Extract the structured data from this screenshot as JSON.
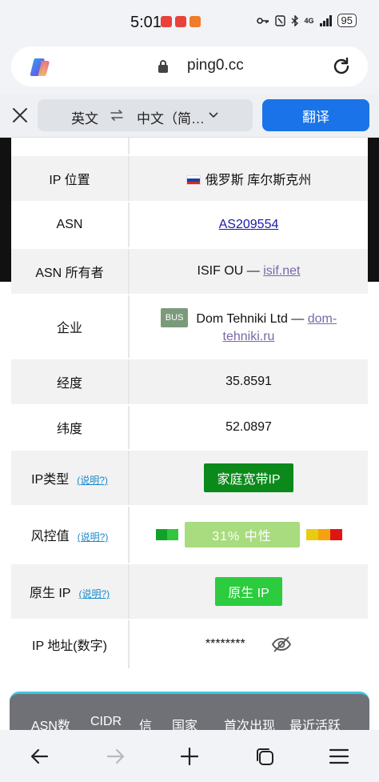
{
  "status_bar": {
    "time": "5:01",
    "network": "4G",
    "battery": "95"
  },
  "address_bar": {
    "url": "ping0.cc"
  },
  "translate_bar": {
    "source_lang": "英文",
    "target_lang": "中文（简…",
    "translate_label": "翻译"
  },
  "table": {
    "rows": [
      {
        "label": "IP 位置",
        "value": "俄罗斯 库尔斯克州"
      },
      {
        "label": "ASN",
        "value": "AS209554"
      },
      {
        "label": "ASN 所有者",
        "value_text": "ISIF OU — ",
        "value_link": "isif.net"
      },
      {
        "label": "企业",
        "tag": "BUS",
        "value_text": "Dom Tehniki Ltd — ",
        "value_link_1": "dom-",
        "value_link_2": "tehniki.ru"
      },
      {
        "label": "经度",
        "value": "35.8591"
      },
      {
        "label": "纬度",
        "value": "52.0897"
      },
      {
        "label": "IP类型",
        "help": "(说明?)",
        "value": "家庭宽带IP"
      },
      {
        "label": "风控值",
        "help": "(说明?)",
        "value": "31%  中性",
        "risk_percent": 31
      },
      {
        "label": "原生 IP",
        "help": "(说明?)",
        "value": "原生 IP"
      },
      {
        "label": "IP 地址(数字)",
        "value": "********"
      }
    ]
  },
  "card2": {
    "headers": [
      "ASN数",
      "CIDR",
      "信",
      "国家",
      "首次出现",
      "最近活跃"
    ]
  },
  "colors": {
    "accent": "#1a73e8",
    "type_badge": "#0b8a1b",
    "native_badge": "#2bcc3e",
    "risk_bar": "#a8dc7e"
  },
  "icons": [
    "copilot-icon",
    "lock-icon",
    "reload-icon",
    "close-icon",
    "swap-icon",
    "chevron-down-icon",
    "eye-off-icon",
    "back-icon",
    "forward-icon",
    "new-tab-icon",
    "tabs-icon",
    "menu-icon"
  ]
}
